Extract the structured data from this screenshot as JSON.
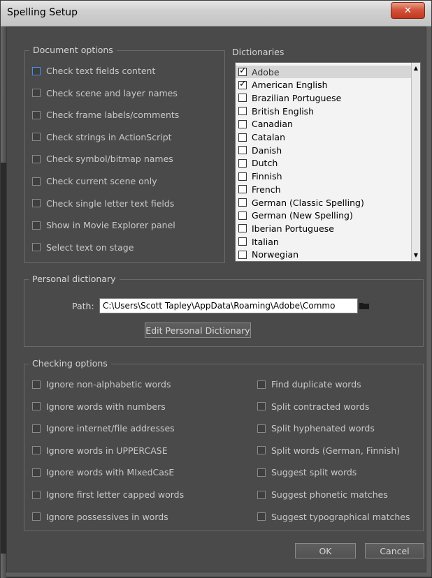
{
  "window": {
    "title": "Spelling Setup",
    "close_glyph": "✕"
  },
  "document_options": {
    "legend": "Document options",
    "items": [
      {
        "label": "Check text fields content",
        "checked": false
      },
      {
        "label": "Check scene and layer names",
        "checked": false
      },
      {
        "label": "Check frame labels/comments",
        "checked": false
      },
      {
        "label": "Check strings in ActionScript",
        "checked": false
      },
      {
        "label": "Check symbol/bitmap names",
        "checked": false
      },
      {
        "label": "Check current scene only",
        "checked": false
      },
      {
        "label": "Check single letter text fields",
        "checked": false
      },
      {
        "label": "Show in Movie Explorer panel",
        "checked": false
      },
      {
        "label": "Select text on stage",
        "checked": false
      }
    ]
  },
  "dictionaries": {
    "label": "Dictionaries",
    "items": [
      {
        "label": "Adobe",
        "checked": true,
        "selected": true
      },
      {
        "label": "American English",
        "checked": true
      },
      {
        "label": "Brazilian Portuguese",
        "checked": false
      },
      {
        "label": "British English",
        "checked": false
      },
      {
        "label": "Canadian",
        "checked": false
      },
      {
        "label": "Catalan",
        "checked": false
      },
      {
        "label": "Danish",
        "checked": false
      },
      {
        "label": "Dutch",
        "checked": false
      },
      {
        "label": "Finnish",
        "checked": false
      },
      {
        "label": "French",
        "checked": false
      },
      {
        "label": "German (Classic Spelling)",
        "checked": false
      },
      {
        "label": "German (New Spelling)",
        "checked": false
      },
      {
        "label": "Iberian Portuguese",
        "checked": false
      },
      {
        "label": "Italian",
        "checked": false
      },
      {
        "label": "Norwegian",
        "checked": false
      }
    ]
  },
  "personal_dictionary": {
    "legend": "Personal dictionary",
    "path_label": "Path:",
    "path_value": "C:\\Users\\Scott Tapley\\AppData\\Roaming\\Adobe\\Commo",
    "edit_button": "Edit Personal Dictionary"
  },
  "checking_options": {
    "legend": "Checking options",
    "left": [
      {
        "label": "Ignore non-alphabetic words",
        "checked": false
      },
      {
        "label": "Ignore words with numbers",
        "checked": false
      },
      {
        "label": "Ignore internet/file addresses",
        "checked": false
      },
      {
        "label": "Ignore words in UPPERCASE",
        "checked": false
      },
      {
        "label": "Ignore words with MIxedCasE",
        "checked": false
      },
      {
        "label": "Ignore first letter capped words",
        "checked": false
      },
      {
        "label": "Ignore possessives in words",
        "checked": false
      }
    ],
    "right": [
      {
        "label": "Find duplicate words",
        "checked": false
      },
      {
        "label": "Split contracted words",
        "checked": false
      },
      {
        "label": "Split hyphenated words",
        "checked": false
      },
      {
        "label": "Split words (German, Finnish)",
        "checked": false
      },
      {
        "label": "Suggest split words",
        "checked": false
      },
      {
        "label": "Suggest phonetic matches",
        "checked": false
      },
      {
        "label": "Suggest typographical matches",
        "checked": false
      }
    ]
  },
  "buttons": {
    "ok": "OK",
    "cancel": "Cancel"
  },
  "colors": {
    "background": "#4a4a4a",
    "text": "#c9c9c9",
    "close": "#c1371f"
  }
}
